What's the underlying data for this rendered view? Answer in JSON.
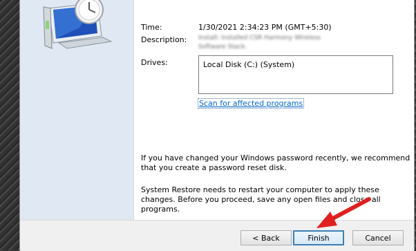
{
  "details": {
    "time_label": "Time:",
    "time_value": "1/30/2021 2:34:23 PM (GMT+5:30)",
    "description_label": "Description:",
    "description_value": "Install: Installed CSR Harmony Wireless Software Stack.",
    "drives_label": "Drives:",
    "drives": [
      "Local Disk (C:) (System)"
    ],
    "scan_link": "Scan for affected programs"
  },
  "notes": {
    "password_note": "If you have changed your Windows password recently, we recommend that you create a password reset disk.",
    "restart_note": "System Restore needs to restart your computer to apply these changes. Before you proceed, save any open files and close all programs."
  },
  "buttons": {
    "back": "< Back",
    "finish": "Finish",
    "cancel": "Cancel"
  },
  "colors": {
    "link": "#0066cc",
    "arrow": "#e02020",
    "side_panel": "#dfe8f3"
  },
  "icons": {
    "illustration": "system-restore-clock-computer",
    "annotation": "red-arrow"
  }
}
